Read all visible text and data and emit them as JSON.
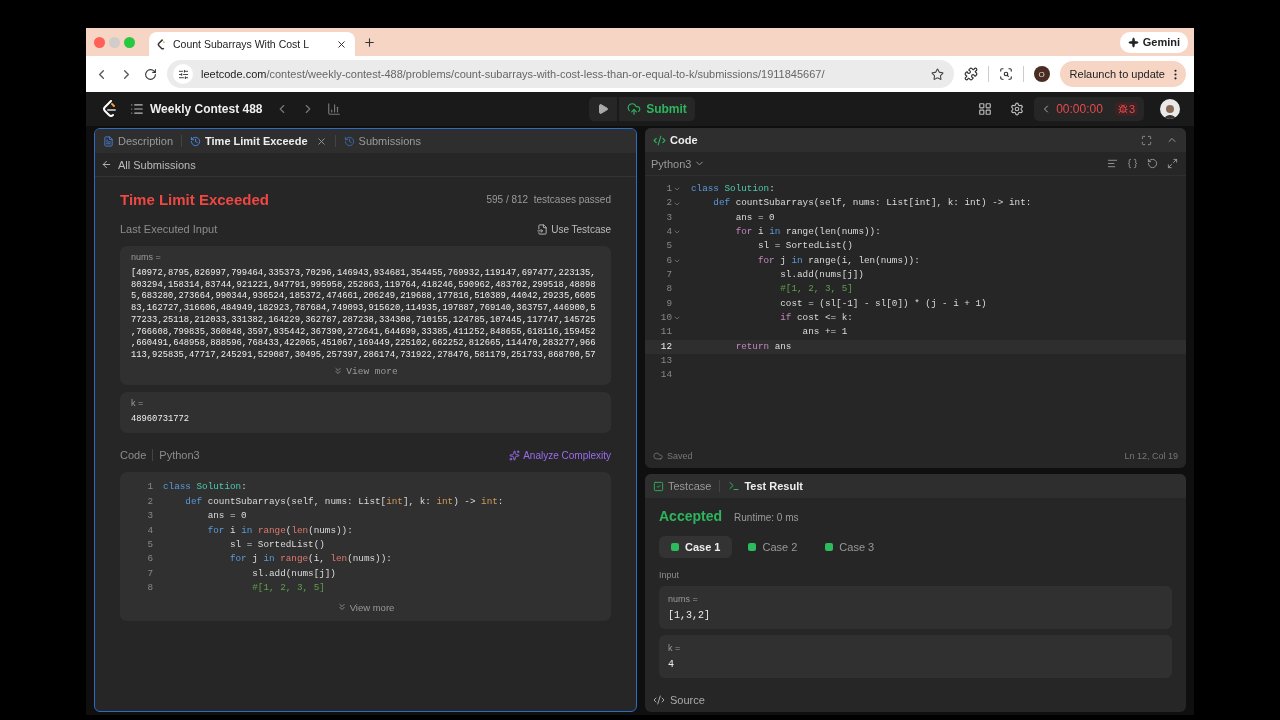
{
  "browser": {
    "tabs": [
      {
        "title": "Count Subarrays With Cost L",
        "selected": true
      }
    ],
    "gemini_button": "Gemini",
    "url": {
      "domain": "leetcode.com",
      "path": "/contest/weekly-contest-488/problems/count-subarrays-with-cost-less-than-or-equal-to-k/submissions/1911845667/"
    },
    "profile": "O",
    "relaunch_button": "Relaunch to update"
  },
  "navbar": {
    "title": "Weekly Contest 488",
    "submit_button": "Submit",
    "timer": "00:00:00",
    "bug_count": "3"
  },
  "left_panel": {
    "tabs": [
      {
        "label": "Description",
        "kind": "doc",
        "selected": false
      },
      {
        "label": "Time Limit Exceede",
        "kind": "history",
        "selected": true
      },
      {
        "label": "Submissions",
        "kind": "history",
        "selected": false
      }
    ],
    "back_link": "All Submissions",
    "status": "Time Limit Exceeded",
    "passed": "595 / 812",
    "passed_label": "testcases passed",
    "last_input_label": "Last Executed Input",
    "use_testcase_button": "Use Testcase",
    "inputs": [
      {
        "label": "nums =",
        "lines": [
          "[40972,8795,826997,799464,335373,70296,146943,934681,354455,769932,119147,697477,223135,",
          "803294,158314,83744,921221,947791,995958,252863,119764,418246,590962,483702,299518,48898",
          "5,683280,273664,990344,936524,185372,474661,206249,219688,177816,510389,44042,29235,6605",
          "83,162727,316606,484949,182923,787684,749093,915620,114935,197887,769140,363757,446900,5",
          "77233,25118,212033,331382,164229,362787,287238,334308,710155,124785,107445,117747,145725",
          ",766608,799835,360848,3597,935442,367390,272641,644699,33385,411252,848655,618116,159452",
          ",660491,648958,888596,768433,422065,451067,169449,225102,662252,812665,114470,283277,966",
          "113,925835,47717,245291,529087,30495,257397,286174,731922,278476,581179,251733,868700,57"
        ],
        "view_more": "View more"
      },
      {
        "label": "k =",
        "lines": [
          "48960731772"
        ]
      }
    ],
    "code_label": "Code",
    "language": "Python3",
    "analyze_button": "Analyze Complexity",
    "code_lines": [
      {
        "num": "1",
        "tokens": [
          {
            "text": "class",
            "kind": "keyword"
          },
          {
            "text": " Solution",
            "kind": "class"
          },
          {
            "text": ":",
            "kind": "plain"
          }
        ]
      },
      {
        "num": "2",
        "tokens": [
          {
            "text": "    def",
            "kind": "keyword"
          },
          {
            "text": " countSubarrays(self, nums: List[",
            "kind": "plain"
          },
          {
            "text": "int",
            "kind": "type"
          },
          {
            "text": "], k: ",
            "kind": "plain"
          },
          {
            "text": "int",
            "kind": "type"
          },
          {
            "text": ") -> ",
            "kind": "plain"
          },
          {
            "text": "int",
            "kind": "type"
          },
          {
            "text": ":",
            "kind": "plain"
          }
        ]
      },
      {
        "num": "3",
        "tokens": [
          {
            "text": "        ans = 0",
            "kind": "plain"
          }
        ]
      },
      {
        "num": "4",
        "tokens": [
          {
            "text": "        for",
            "kind": "keyword"
          },
          {
            "text": " i ",
            "kind": "plain"
          },
          {
            "text": "in",
            "kind": "keyword"
          },
          {
            "text": " range",
            "kind": "builtin"
          },
          {
            "text": "(",
            "kind": "plain"
          },
          {
            "text": "len",
            "kind": "builtin"
          },
          {
            "text": "(nums)):",
            "kind": "plain"
          }
        ]
      },
      {
        "num": "5",
        "tokens": [
          {
            "text": "            sl = SortedList()",
            "kind": "plain"
          }
        ]
      },
      {
        "num": "6",
        "tokens": [
          {
            "text": "            for",
            "kind": "keyword"
          },
          {
            "text": " j ",
            "kind": "plain"
          },
          {
            "text": "in",
            "kind": "keyword"
          },
          {
            "text": " range",
            "kind": "builtin"
          },
          {
            "text": "(i, ",
            "kind": "plain"
          },
          {
            "text": "len",
            "kind": "builtin"
          },
          {
            "text": "(nums)):",
            "kind": "plain"
          }
        ]
      },
      {
        "num": "7",
        "tokens": [
          {
            "text": "                sl.add(nums[j])",
            "kind": "plain"
          }
        ]
      },
      {
        "num": "8",
        "tokens": [
          {
            "text": "                #[1, 2, 3, 5]",
            "kind": "comment"
          }
        ]
      }
    ],
    "code_view_more": "View more"
  },
  "editor": {
    "title": "Code",
    "language": "Python3",
    "lines": [
      {
        "num": "1",
        "fold": true,
        "current": false,
        "tokens": [
          {
            "text": "class",
            "kind": "keyword"
          },
          {
            "text": " Solution",
            "kind": "class"
          },
          {
            "text": ":",
            "kind": "plain"
          }
        ]
      },
      {
        "num": "2",
        "fold": true,
        "current": false,
        "tokens": [
          {
            "text": "    def",
            "kind": "keyword"
          },
          {
            "text": " countSubarrays(self, nums: List[int], k: int) -> int:",
            "kind": "plain"
          }
        ]
      },
      {
        "num": "3",
        "fold": false,
        "current": false,
        "tokens": [
          {
            "text": "        ans = 0",
            "kind": "plain"
          }
        ]
      },
      {
        "num": "4",
        "fold": true,
        "current": false,
        "tokens": [
          {
            "text": "        for",
            "kind": "control"
          },
          {
            "text": " i ",
            "kind": "plain"
          },
          {
            "text": "in",
            "kind": "keyword"
          },
          {
            "text": " range(len(nums)):",
            "kind": "plain"
          }
        ]
      },
      {
        "num": "5",
        "fold": false,
        "current": false,
        "tokens": [
          {
            "text": "            sl = SortedList()",
            "kind": "plain"
          }
        ]
      },
      {
        "num": "6",
        "fold": true,
        "current": false,
        "tokens": [
          {
            "text": "            for",
            "kind": "control"
          },
          {
            "text": " j ",
            "kind": "plain"
          },
          {
            "text": "in",
            "kind": "keyword"
          },
          {
            "text": " range(i, len(nums)):",
            "kind": "plain"
          }
        ]
      },
      {
        "num": "7",
        "fold": false,
        "current": false,
        "tokens": [
          {
            "text": "                sl.add(nums[j])",
            "kind": "plain"
          }
        ]
      },
      {
        "num": "8",
        "fold": false,
        "current": false,
        "tokens": [
          {
            "text": "                #[1, 2, 3, 5]",
            "kind": "comment"
          }
        ]
      },
      {
        "num": "9",
        "fold": false,
        "current": false,
        "tokens": [
          {
            "text": "                cost = (sl[-1] - sl[0]) * (j - i + 1)",
            "kind": "plain"
          }
        ]
      },
      {
        "num": "10",
        "fold": true,
        "current": false,
        "tokens": [
          {
            "text": "                if",
            "kind": "control"
          },
          {
            "text": " cost <= k:",
            "kind": "plain"
          }
        ]
      },
      {
        "num": "11",
        "fold": false,
        "current": false,
        "tokens": [
          {
            "text": "                    ans += 1",
            "kind": "plain"
          }
        ]
      },
      {
        "num": "12",
        "fold": false,
        "current": true,
        "tokens": [
          {
            "text": "        return",
            "kind": "control"
          },
          {
            "text": " ans",
            "kind": "plain"
          }
        ]
      },
      {
        "num": "13",
        "fold": false,
        "current": false
      },
      {
        "num": "14",
        "fold": false,
        "current": false
      }
    ],
    "saved": "Saved",
    "cursor_pos": "Ln 12, Col 19"
  },
  "result_panel": {
    "tabs": [
      {
        "label": "Testcase",
        "kind": "check",
        "selected": false
      },
      {
        "label": "Test Result",
        "kind": "terminal",
        "selected": true
      }
    ],
    "verdict": "Accepted",
    "runtime": "Runtime: 0 ms",
    "cases": [
      {
        "label": "Case 1",
        "selected": true,
        "passed": true
      },
      {
        "label": "Case 2",
        "selected": false,
        "passed": true
      },
      {
        "label": "Case 3",
        "selected": false,
        "passed": true
      }
    ],
    "input_label": "Input",
    "inputs": [
      {
        "label": "nums =",
        "value": "[1,3,2]"
      },
      {
        "label": "k =",
        "value": "4"
      }
    ],
    "source": "Source"
  }
}
